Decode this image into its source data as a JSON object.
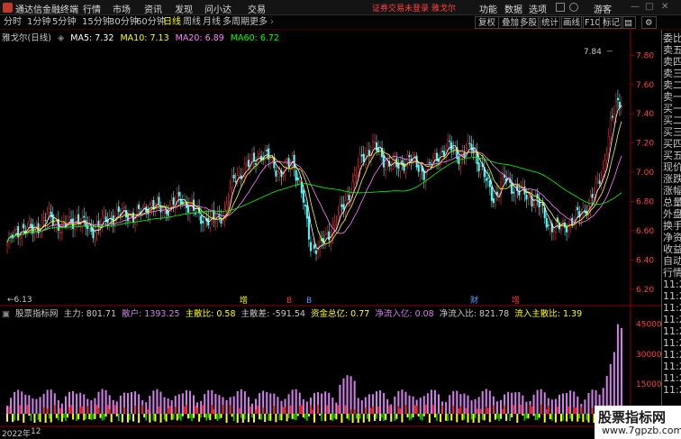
{
  "titlebar": {
    "app_name": "通达信金融终端",
    "menus": [
      "行情",
      "市场",
      "资讯",
      "发现",
      "问小达",
      "交易"
    ],
    "status": "证券交易未登录  雅戈尔",
    "right": [
      "功能",
      "数据",
      "选项",
      "游客"
    ]
  },
  "toolbar": {
    "periods": [
      "分时",
      "1分钟",
      "5分钟",
      "15分钟",
      "30分钟",
      "60分钟",
      "日线",
      "周线",
      "月线",
      "多周期",
      "更多"
    ],
    "active_period": "日线",
    "tools": [
      "复权",
      "叠加",
      "多股",
      "统计",
      "画线",
      "F10",
      "标记"
    ]
  },
  "info": {
    "stock": "雅戈尔(日线)",
    "ma5": "MA5: 7.32",
    "ma10": "MA10: 7.13",
    "ma20": "MA20: 6.89",
    "ma60": "MA60: 6.72"
  },
  "price_axis": [
    "7.80",
    "7.60",
    "7.40",
    "7.20",
    "7.00",
    "6.80",
    "6.60",
    "6.40",
    "6.20"
  ],
  "annotations": {
    "high": "7.84",
    "low": "6.13",
    "events": [
      "增",
      "B",
      "B",
      "财",
      "增"
    ]
  },
  "indicator": {
    "name": "股票指标网",
    "main": "主力: 801.71",
    "retail": "散户: 1393.25",
    "main_ratio": "主散比: 0.58",
    "main_diff": "主散差: -591.54",
    "fund_total": "资金总亿: 0.77",
    "net_inflow": "净流入亿: 0.08",
    "net_ratio": "净流入比: 821.78",
    "inflow_ratio": "流入主散比: 1.39"
  },
  "indicator_axis": [
    "45000",
    "30000",
    "15000",
    "0.00"
  ],
  "x_axis": [
    "2022年",
    "12"
  ],
  "side_panel": [
    "委比",
    "卖五",
    "卖四",
    "卖三",
    "卖二",
    "卖一",
    "买一",
    "买二",
    "买三",
    "买四",
    "买五",
    "现价",
    "涨跌",
    "涨幅",
    "总量",
    "外盘",
    "换手",
    "净资",
    "收益",
    "自动",
    "行情",
    "11:29",
    "11:29",
    "11:29",
    "11:29",
    "11:29",
    "11:29",
    "11:29",
    "11:29",
    "11:29",
    "11:29"
  ],
  "watermark": {
    "title": "股票指标网",
    "url": "www.7gpzb.com"
  },
  "colors": {
    "up": "#ff3232",
    "down": "#54ffff",
    "ma5": "#ffffff",
    "ma10": "#ffff00",
    "ma20": "#ff80ff",
    "ma60": "#00ff00",
    "bar_purple": "#d080e8",
    "bar_yellow": "#ffff00",
    "bar_red": "#ff2020",
    "bar_green": "#00d000"
  }
}
